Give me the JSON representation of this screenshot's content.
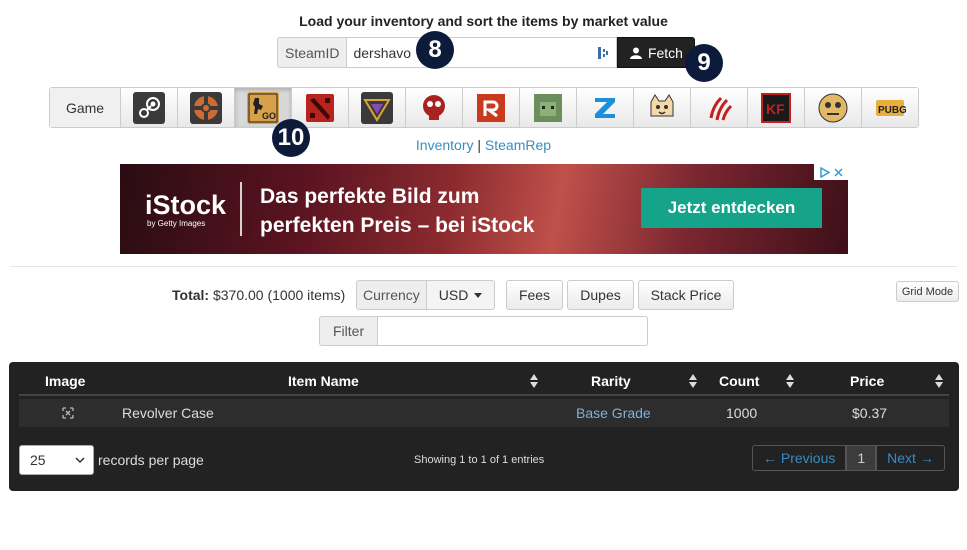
{
  "heading": "Load your inventory and sort the items by market value",
  "steam": {
    "addon": "SteamID",
    "value": "dershavo",
    "fetch_label": "Fetch"
  },
  "badges": {
    "b8": "8",
    "b9": "9",
    "b10": "10"
  },
  "games": {
    "label": "Game",
    "items": [
      "steam-icon",
      "tf2-icon",
      "csgo-icon",
      "dota2-icon",
      "artifact-icon",
      "killing-floor-icon",
      "rust-icon",
      "unturned-icon",
      "z-icon",
      "pink-cat-icon",
      "claw-icon",
      "killing-floor-2-icon",
      "h1z1-icon",
      "pubg-icon"
    ],
    "selected": "csgo-icon"
  },
  "links": {
    "inventory": "Inventory",
    "sep": "|",
    "steamrep": "SteamRep"
  },
  "ad": {
    "logo": "iStock",
    "logo_sub": "by Getty Images",
    "line1": "Das perfekte Bild zum",
    "line2": "perfekten Preis – bei iStock",
    "cta": "Jetzt entdecken"
  },
  "controls": {
    "total_label": "Total:",
    "total_value": "$370.00 (1000 items)",
    "currency_label": "Currency",
    "currency_value": "USD",
    "fees": "Fees",
    "dupes": "Dupes",
    "stack_price": "Stack Price",
    "grid_mode": "Grid Mode",
    "filter_label": "Filter",
    "filter_value": ""
  },
  "table": {
    "headers": {
      "image": "Image",
      "name": "Item Name",
      "rarity": "Rarity",
      "count": "Count",
      "price": "Price"
    },
    "rows": [
      {
        "name": "Revolver Case",
        "rarity": "Base Grade",
        "count": "1000",
        "price": "$0.37"
      }
    ],
    "per_page": "25",
    "per_page_label": "records per page",
    "showing": "Showing 1 to 1 of 1 entries",
    "prev": "← Previous",
    "page": "1",
    "next": "Next →"
  },
  "colors": {
    "accent_link": "#3a8bbf",
    "badge_bg": "#0d1b3a",
    "cta": "#15a38a",
    "panel": "#222222"
  }
}
